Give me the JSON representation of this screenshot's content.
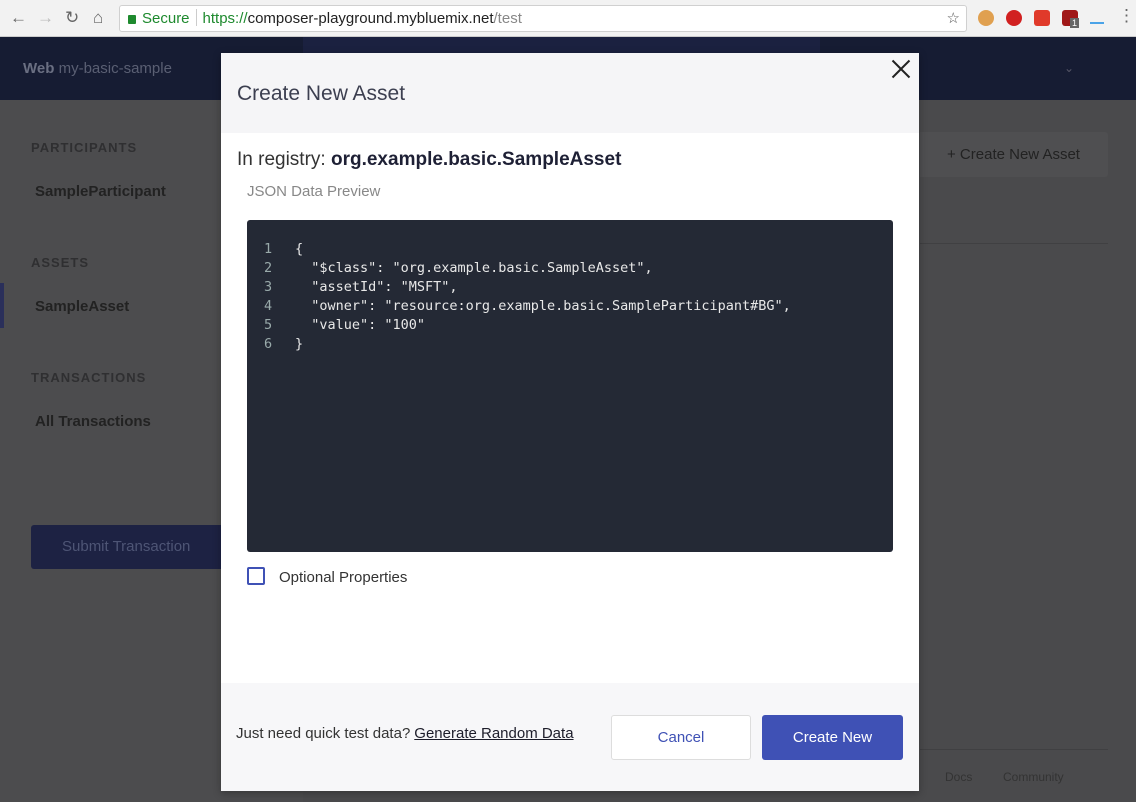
{
  "browser": {
    "secure_label": "Secure",
    "url_scheme": "https://",
    "url_host": "composer-playground.mybluemix.net",
    "url_path": "/test",
    "ext_badge": "1"
  },
  "header": {
    "brand_bold": "Web",
    "brand_name": "my-basic-sample"
  },
  "sidebar": {
    "participants_title": "PARTICIPANTS",
    "participants": [
      "SampleParticipant"
    ],
    "assets_title": "ASSETS",
    "assets": [
      "SampleAsset"
    ],
    "transactions_title": "TRANSACTIONS",
    "transactions": [
      "All Transactions"
    ],
    "submit_label": "Submit Transaction"
  },
  "main": {
    "create_asset_label": "+ Create New Asset",
    "footer_links": [
      "Docs",
      "Community"
    ]
  },
  "modal": {
    "title": "Create New Asset",
    "registry_prefix": "In registry:",
    "registry_name": "org.example.basic.SampleAsset",
    "json_label": "JSON Data Preview",
    "code_lines": [
      {
        "n": "1",
        "t": "{"
      },
      {
        "n": "2",
        "t": "  \"$class\": \"org.example.basic.SampleAsset\","
      },
      {
        "n": "3",
        "t": "  \"assetId\": \"MSFT\","
      },
      {
        "n": "4",
        "t": "  \"owner\": \"resource:org.example.basic.SampleParticipant#BG\","
      },
      {
        "n": "5",
        "t": "  \"value\": \"100\""
      },
      {
        "n": "6",
        "t": "}"
      }
    ],
    "optional_label": "Optional Properties",
    "optional_checked": false,
    "quick_text": "Just need quick test data?",
    "generate_link": "Generate Random Data",
    "cancel_label": "Cancel",
    "create_label": "Create New"
  }
}
